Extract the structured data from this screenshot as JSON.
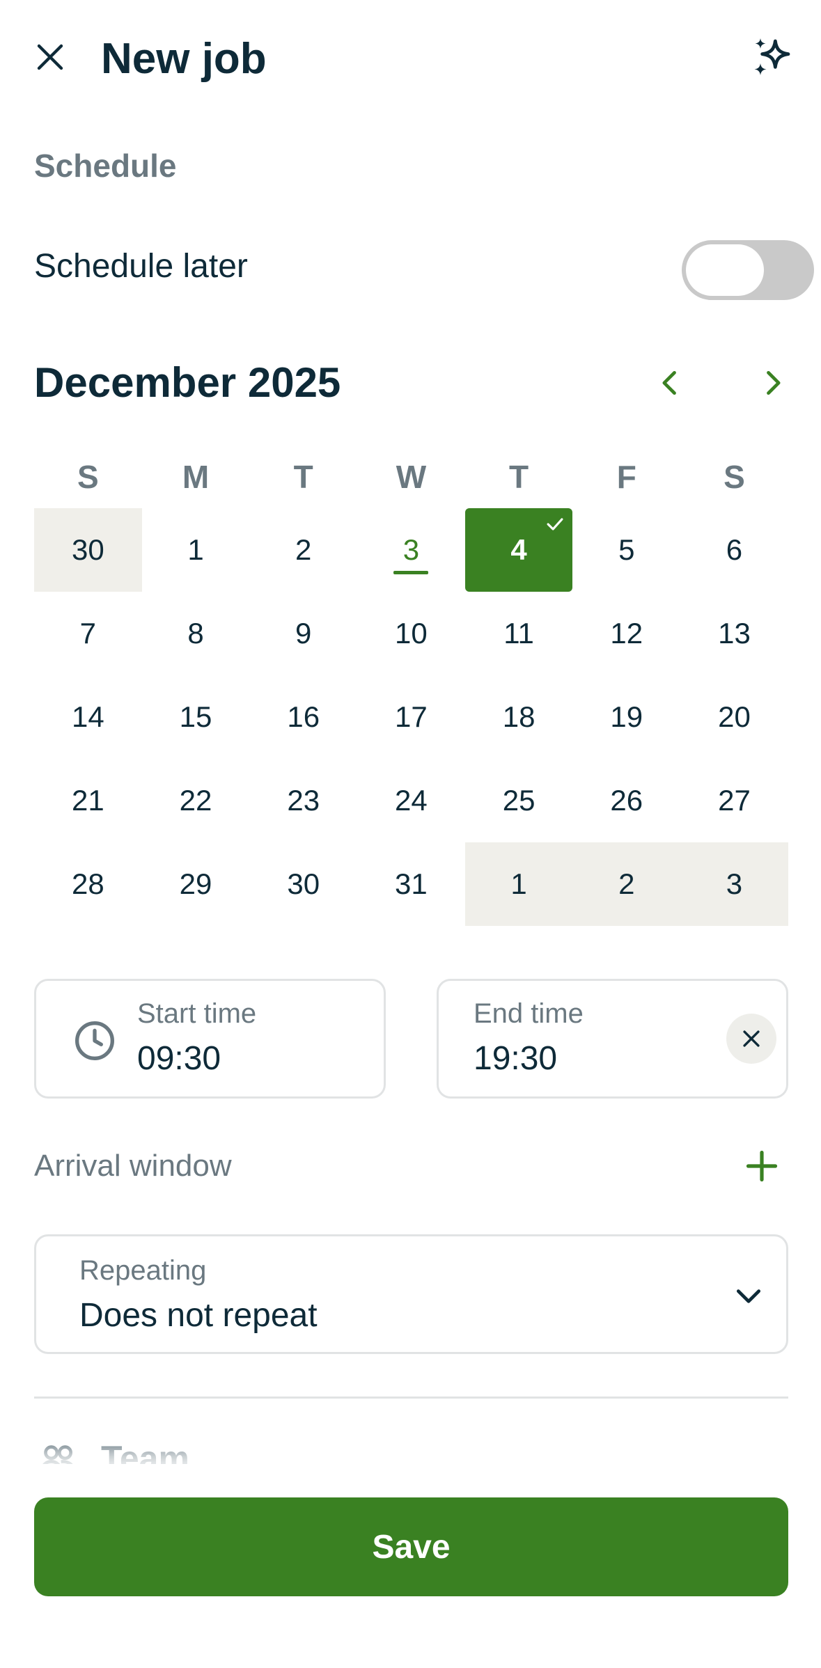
{
  "header": {
    "title": "New job"
  },
  "schedule": {
    "section_label": "Schedule",
    "schedule_later_label": "Schedule later",
    "schedule_later_on": false
  },
  "calendar": {
    "month_title": "December 2025",
    "weekdays": [
      "S",
      "M",
      "T",
      "W",
      "T",
      "F",
      "S"
    ],
    "weeks": [
      [
        "30",
        "1",
        "2",
        "3",
        "4",
        "5",
        "6"
      ],
      [
        "7",
        "8",
        "9",
        "10",
        "11",
        "12",
        "13"
      ],
      [
        "14",
        "15",
        "16",
        "17",
        "18",
        "19",
        "20"
      ],
      [
        "21",
        "22",
        "23",
        "24",
        "25",
        "26",
        "27"
      ],
      [
        "28",
        "29",
        "30",
        "31",
        "1",
        "2",
        "3"
      ]
    ],
    "today": "3",
    "selected": "4"
  },
  "times": {
    "start_label": "Start time",
    "start_value": "09:30",
    "end_label": "End time",
    "end_value": "19:30"
  },
  "arrival": {
    "label": "Arrival window"
  },
  "repeating": {
    "label": "Repeating",
    "value": "Does not repeat"
  },
  "team": {
    "label": "Team"
  },
  "footer": {
    "save_label": "Save"
  },
  "colors": {
    "accent": "#3a8122",
    "text": "#0e2a38",
    "muted": "#6a7880",
    "outside_day": "#f0efea"
  }
}
